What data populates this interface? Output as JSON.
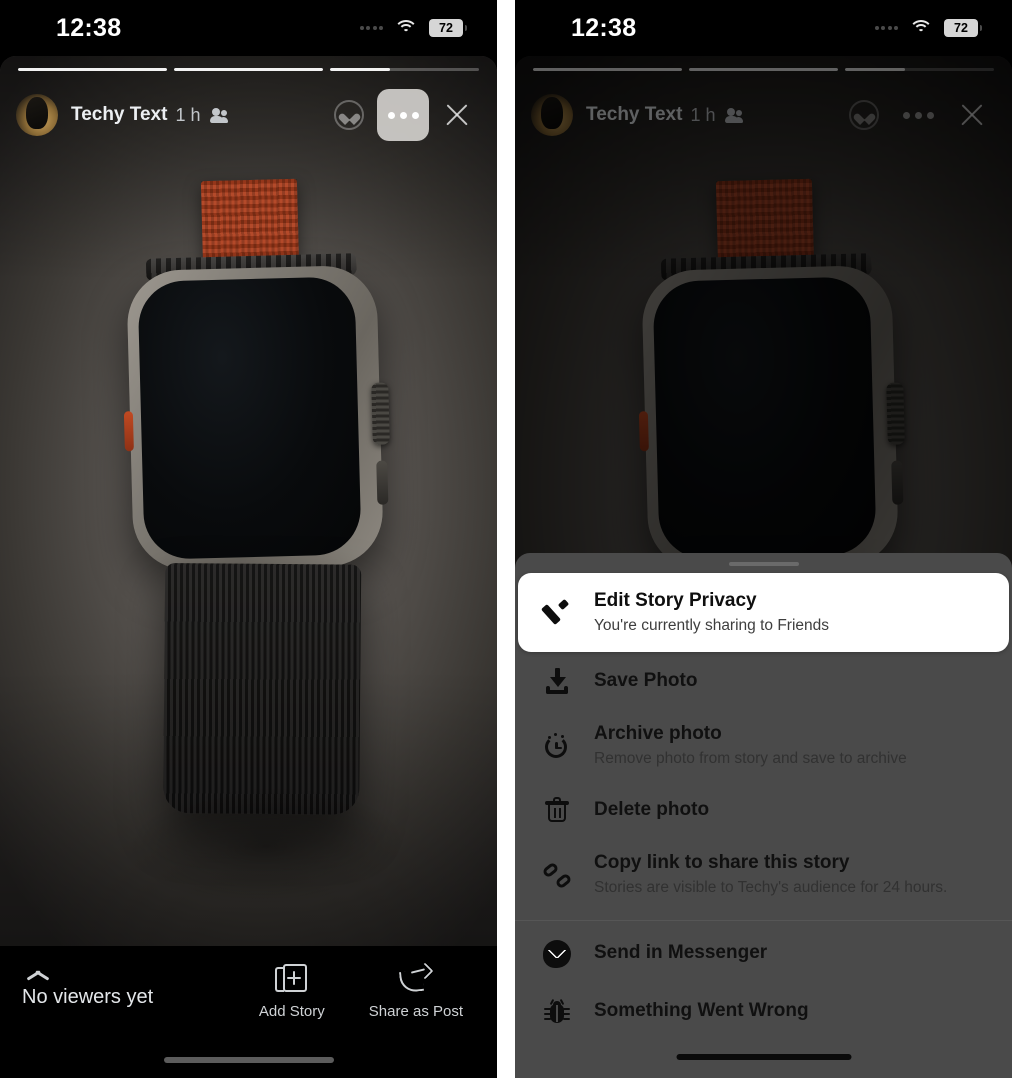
{
  "status_bar": {
    "time": "12:38",
    "signal_icon": "cellular-signal-icon",
    "wifi_icon": "wifi-icon",
    "battery_level": "72"
  },
  "story": {
    "progress_segments": [
      100,
      100,
      40
    ],
    "author": "Techy Text",
    "timestamp": "1 h",
    "audience_icon": "friends-icon",
    "media_description": "Apple Watch Ultra with orange alpine loop band on gray surface",
    "header_actions": {
      "react_label": "react-icon",
      "more_label": "more-options-icon",
      "close_label": "close-icon"
    }
  },
  "story_footer": {
    "viewers_text": "No viewers yet",
    "chevron_icon": "chevron-up-icon",
    "actions": [
      {
        "label": "Add Story",
        "icon": "add-story-icon"
      },
      {
        "label": "Share as Post",
        "icon": "share-arrow-icon"
      }
    ]
  },
  "action_sheet": {
    "drag_handle": "drag-handle",
    "groups": [
      {
        "items": [
          {
            "title": "Edit Story Privacy",
            "subtitle": "You're currently sharing to Friends",
            "icon": "pencil-icon",
            "featured": true
          },
          {
            "title": "Save Photo",
            "subtitle": "",
            "icon": "download-icon",
            "featured": false
          },
          {
            "title": "Archive photo",
            "subtitle": "Remove photo from story and save to archive",
            "icon": "archive-clock-icon",
            "featured": false
          },
          {
            "title": "Delete photo",
            "subtitle": "",
            "icon": "trash-icon",
            "featured": false
          },
          {
            "title": "Copy link to share this story",
            "subtitle": "Stories are visible to Techy's audience for 24 hours.",
            "icon": "link-icon",
            "featured": false
          }
        ]
      },
      {
        "items": [
          {
            "title": "Send in Messenger",
            "subtitle": "",
            "icon": "messenger-icon",
            "featured": false
          },
          {
            "title": "Something Went Wrong",
            "subtitle": "",
            "icon": "bug-icon",
            "featured": false
          }
        ]
      }
    ]
  },
  "colors": {
    "sheet_background": "#4a4a4a",
    "featured_background": "#ffffff",
    "band_orange": "#b0401f",
    "text_primary": "#0f0f0f",
    "screen_black": "#000000"
  }
}
